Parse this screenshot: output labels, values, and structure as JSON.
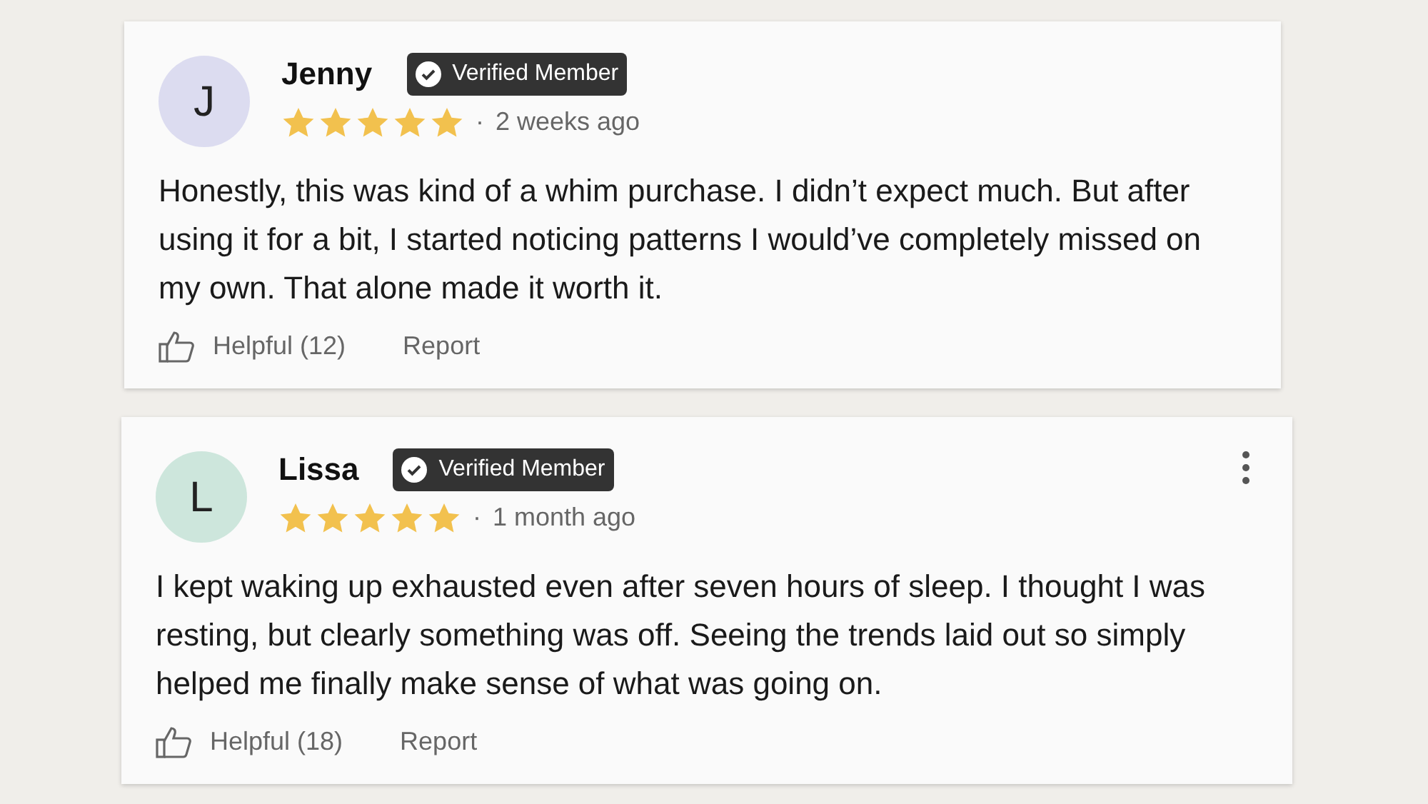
{
  "reviews": [
    {
      "initial": "J",
      "color": "#dcdcf0",
      "name": "Jenny",
      "verified": true,
      "badge": "Verified Member",
      "stars": 5,
      "separator": "·",
      "time": "2 weeks ago",
      "menu": false,
      "text": "Honestly, this was kind of a whim purchase. I didn’t expect much. But after using it for a bit, I started noticing patterns I would’ve completely missed on my own. That alone made it worth it.",
      "helpful": "Helpful (12)",
      "report": "Report"
    },
    {
      "initial": "L",
      "color": "#cde6dc",
      "name": "Lissa",
      "verified": true,
      "badge": "Verified Member",
      "stars": 5,
      "separator": "·",
      "time": "1 month ago",
      "menu": true,
      "text": "I kept waking up exhausted even after seven hours of sleep. I thought I was resting, but clearly something was off. Seeing the trends laid out so simply helped me finally make sense of what was going on.",
      "helpful": "Helpful (18)",
      "report": "Report"
    }
  ]
}
